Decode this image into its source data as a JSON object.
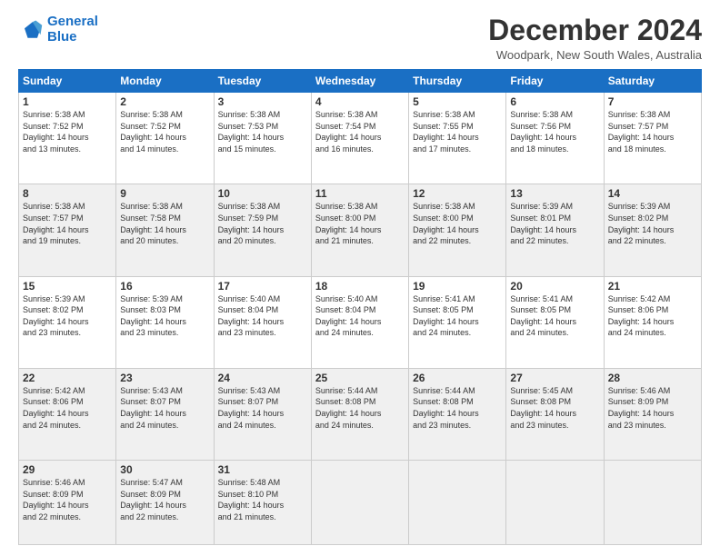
{
  "logo": {
    "line1": "General",
    "line2": "Blue"
  },
  "title": "December 2024",
  "location": "Woodpark, New South Wales, Australia",
  "weekdays": [
    "Sunday",
    "Monday",
    "Tuesday",
    "Wednesday",
    "Thursday",
    "Friday",
    "Saturday"
  ],
  "weeks": [
    [
      {
        "day": "1",
        "info": "Sunrise: 5:38 AM\nSunset: 7:52 PM\nDaylight: 14 hours\nand 13 minutes."
      },
      {
        "day": "2",
        "info": "Sunrise: 5:38 AM\nSunset: 7:52 PM\nDaylight: 14 hours\nand 14 minutes."
      },
      {
        "day": "3",
        "info": "Sunrise: 5:38 AM\nSunset: 7:53 PM\nDaylight: 14 hours\nand 15 minutes."
      },
      {
        "day": "4",
        "info": "Sunrise: 5:38 AM\nSunset: 7:54 PM\nDaylight: 14 hours\nand 16 minutes."
      },
      {
        "day": "5",
        "info": "Sunrise: 5:38 AM\nSunset: 7:55 PM\nDaylight: 14 hours\nand 17 minutes."
      },
      {
        "day": "6",
        "info": "Sunrise: 5:38 AM\nSunset: 7:56 PM\nDaylight: 14 hours\nand 18 minutes."
      },
      {
        "day": "7",
        "info": "Sunrise: 5:38 AM\nSunset: 7:57 PM\nDaylight: 14 hours\nand 18 minutes."
      }
    ],
    [
      {
        "day": "8",
        "info": "Sunrise: 5:38 AM\nSunset: 7:57 PM\nDaylight: 14 hours\nand 19 minutes."
      },
      {
        "day": "9",
        "info": "Sunrise: 5:38 AM\nSunset: 7:58 PM\nDaylight: 14 hours\nand 20 minutes."
      },
      {
        "day": "10",
        "info": "Sunrise: 5:38 AM\nSunset: 7:59 PM\nDaylight: 14 hours\nand 20 minutes."
      },
      {
        "day": "11",
        "info": "Sunrise: 5:38 AM\nSunset: 8:00 PM\nDaylight: 14 hours\nand 21 minutes."
      },
      {
        "day": "12",
        "info": "Sunrise: 5:38 AM\nSunset: 8:00 PM\nDaylight: 14 hours\nand 22 minutes."
      },
      {
        "day": "13",
        "info": "Sunrise: 5:39 AM\nSunset: 8:01 PM\nDaylight: 14 hours\nand 22 minutes."
      },
      {
        "day": "14",
        "info": "Sunrise: 5:39 AM\nSunset: 8:02 PM\nDaylight: 14 hours\nand 22 minutes."
      }
    ],
    [
      {
        "day": "15",
        "info": "Sunrise: 5:39 AM\nSunset: 8:02 PM\nDaylight: 14 hours\nand 23 minutes."
      },
      {
        "day": "16",
        "info": "Sunrise: 5:39 AM\nSunset: 8:03 PM\nDaylight: 14 hours\nand 23 minutes."
      },
      {
        "day": "17",
        "info": "Sunrise: 5:40 AM\nSunset: 8:04 PM\nDaylight: 14 hours\nand 23 minutes."
      },
      {
        "day": "18",
        "info": "Sunrise: 5:40 AM\nSunset: 8:04 PM\nDaylight: 14 hours\nand 24 minutes."
      },
      {
        "day": "19",
        "info": "Sunrise: 5:41 AM\nSunset: 8:05 PM\nDaylight: 14 hours\nand 24 minutes."
      },
      {
        "day": "20",
        "info": "Sunrise: 5:41 AM\nSunset: 8:05 PM\nDaylight: 14 hours\nand 24 minutes."
      },
      {
        "day": "21",
        "info": "Sunrise: 5:42 AM\nSunset: 8:06 PM\nDaylight: 14 hours\nand 24 minutes."
      }
    ],
    [
      {
        "day": "22",
        "info": "Sunrise: 5:42 AM\nSunset: 8:06 PM\nDaylight: 14 hours\nand 24 minutes."
      },
      {
        "day": "23",
        "info": "Sunrise: 5:43 AM\nSunset: 8:07 PM\nDaylight: 14 hours\nand 24 minutes."
      },
      {
        "day": "24",
        "info": "Sunrise: 5:43 AM\nSunset: 8:07 PM\nDaylight: 14 hours\nand 24 minutes."
      },
      {
        "day": "25",
        "info": "Sunrise: 5:44 AM\nSunset: 8:08 PM\nDaylight: 14 hours\nand 24 minutes."
      },
      {
        "day": "26",
        "info": "Sunrise: 5:44 AM\nSunset: 8:08 PM\nDaylight: 14 hours\nand 23 minutes."
      },
      {
        "day": "27",
        "info": "Sunrise: 5:45 AM\nSunset: 8:08 PM\nDaylight: 14 hours\nand 23 minutes."
      },
      {
        "day": "28",
        "info": "Sunrise: 5:46 AM\nSunset: 8:09 PM\nDaylight: 14 hours\nand 23 minutes."
      }
    ],
    [
      {
        "day": "29",
        "info": "Sunrise: 5:46 AM\nSunset: 8:09 PM\nDaylight: 14 hours\nand 22 minutes."
      },
      {
        "day": "30",
        "info": "Sunrise: 5:47 AM\nSunset: 8:09 PM\nDaylight: 14 hours\nand 22 minutes."
      },
      {
        "day": "31",
        "info": "Sunrise: 5:48 AM\nSunset: 8:10 PM\nDaylight: 14 hours\nand 21 minutes."
      },
      {
        "day": "",
        "info": ""
      },
      {
        "day": "",
        "info": ""
      },
      {
        "day": "",
        "info": ""
      },
      {
        "day": "",
        "info": ""
      }
    ]
  ]
}
